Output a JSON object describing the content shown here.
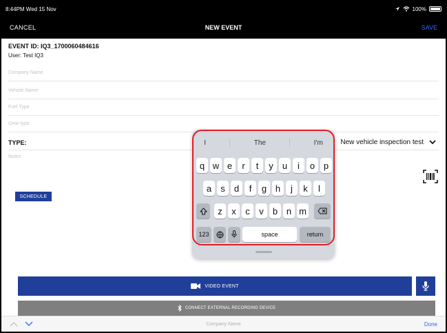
{
  "statusbar": {
    "time": "8:44PM  Wed 15 Nov",
    "battery": "100%"
  },
  "navbar": {
    "cancel_label": "CANCEL",
    "title": "NEW EVENT",
    "save_label": "SAVE"
  },
  "event": {
    "id": "EVENT ID: IQ3_1700060484616",
    "user": "User: Test IQ3"
  },
  "fields": [
    {
      "placeholder": "Company Name"
    },
    {
      "placeholder": "Vehicle Name"
    },
    {
      "placeholder": "Fuel Type"
    },
    {
      "placeholder": "Gear type"
    }
  ],
  "type": {
    "label": "TYPE:",
    "value": "New vehicle inspection test"
  },
  "notes": {
    "placeholder": "Notes"
  },
  "buttons": {
    "schedule_label": "SCHEDULE",
    "video_label": "VIDEO EVENT",
    "connect_label": "CONNECT EXTERNAL RECORDING DEVICE"
  },
  "keyboard": {
    "suggestions": [
      "I",
      "The",
      "I'm"
    ],
    "row1": [
      "q",
      "w",
      "e",
      "r",
      "t",
      "y",
      "u",
      "i",
      "o",
      "p"
    ],
    "row2": [
      "a",
      "s",
      "d",
      "f",
      "g",
      "h",
      "j",
      "k",
      "l"
    ],
    "row3": [
      "z",
      "x",
      "c",
      "v",
      "b",
      "n",
      "m"
    ],
    "numbers_label": "123",
    "space_label": "space",
    "return_label": "return"
  },
  "accessory": {
    "field_label": "Company Name",
    "done_label": "Done"
  },
  "colors": {
    "primary_blue": "#1f3f9a",
    "link_blue": "#2b6cff",
    "highlight_red": "#e31b23"
  },
  "icons": [
    "wifi-icon",
    "battery-icon",
    "chevron-down-icon",
    "barcode-icon",
    "video-camera-icon",
    "microphone-icon",
    "bluetooth-icon",
    "shift-icon",
    "backspace-icon",
    "globe-icon",
    "dictation-icon",
    "chevron-up-icon"
  ]
}
